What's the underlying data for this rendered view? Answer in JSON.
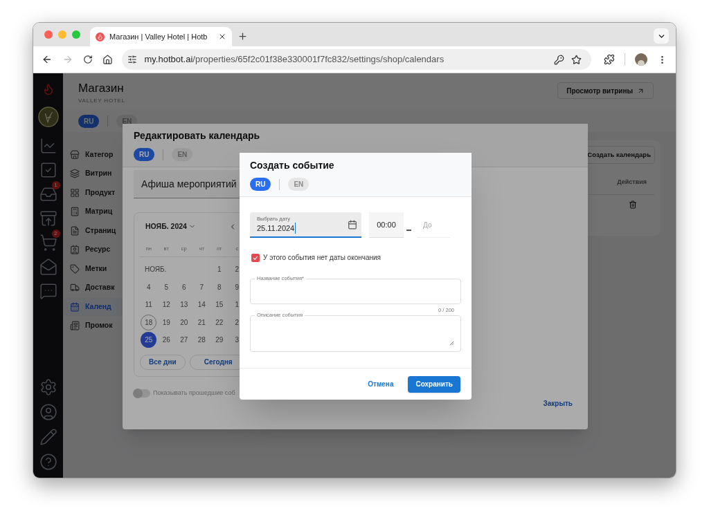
{
  "browser": {
    "tab_title": "Магазин | Valley Hotel | Hotb",
    "url_host": "my.hotbot.ai",
    "url_path": "/properties/65f2c01f38e330001f7fc832/settings/shop/calendars"
  },
  "sidebar": {
    "items": [
      {
        "kind": "chart"
      },
      {
        "kind": "check"
      },
      {
        "kind": "inbox",
        "badge": "1"
      },
      {
        "kind": "tray-star"
      },
      {
        "kind": "cart",
        "badge": "2"
      },
      {
        "kind": "mail"
      },
      {
        "kind": "chat"
      }
    ],
    "bottom_items": [
      {
        "kind": "settings"
      },
      {
        "kind": "user"
      },
      {
        "kind": "pencil"
      },
      {
        "kind": "help"
      }
    ]
  },
  "page": {
    "title": "Магазин",
    "subtitle": "VALLEY HOTEL",
    "preview_button": "Просмотр витрины",
    "languages": [
      {
        "label": "RU",
        "selected": true
      },
      {
        "label": "EN",
        "selected": false
      }
    ],
    "menu": [
      {
        "label": "Категор",
        "kind": "store",
        "selected": false
      },
      {
        "label": "Витрин",
        "kind": "cards",
        "selected": false
      },
      {
        "label": "Продукт",
        "kind": "grid",
        "selected": false
      },
      {
        "label": "Матриц",
        "kind": "matrix",
        "selected": false
      },
      {
        "label": "Страниц",
        "kind": "page",
        "selected": false
      },
      {
        "label": "Ресурс",
        "kind": "resource",
        "selected": false
      },
      {
        "label": "Метки",
        "kind": "tag",
        "selected": false
      },
      {
        "label": "Доставк",
        "kind": "truck",
        "selected": false
      },
      {
        "label": "Календ",
        "kind": "calendar",
        "selected": true
      },
      {
        "label": "Промок",
        "kind": "promo",
        "selected": false
      }
    ],
    "create_calendar_button": "Создать календарь",
    "actions_header": "Действия"
  },
  "edit_dialog": {
    "title": "Редактировать календарь",
    "languages": [
      {
        "label": "RU",
        "selected": true
      },
      {
        "label": "EN",
        "selected": false
      }
    ],
    "name_value": "Афиша мероприятий",
    "calendar": {
      "month_label": "НОЯБ. 2024",
      "weekdays": [
        "пн",
        "вт",
        "ср",
        "чт",
        "пт",
        "с"
      ],
      "month_short": "НОЯБ.",
      "first_days": [
        {
          "text": "1",
          "selected": false,
          "today": false
        },
        {
          "text": "2",
          "selected": false,
          "today": false
        }
      ],
      "weeks": [
        [
          {
            "text": "4",
            "selected": false,
            "today": false
          },
          {
            "text": "5",
            "selected": false,
            "today": false
          },
          {
            "text": "6",
            "selected": false,
            "today": false
          },
          {
            "text": "7",
            "selected": false,
            "today": false
          },
          {
            "text": "8",
            "selected": false,
            "today": false
          },
          {
            "text": "9",
            "selected": false,
            "today": false
          }
        ],
        [
          {
            "text": "11",
            "selected": false,
            "today": false
          },
          {
            "text": "12",
            "selected": false,
            "today": false
          },
          {
            "text": "13",
            "selected": false,
            "today": false
          },
          {
            "text": "14",
            "selected": false,
            "today": false
          },
          {
            "text": "15",
            "selected": false,
            "today": false
          },
          {
            "text": "1",
            "selected": false,
            "today": false
          }
        ],
        [
          {
            "text": "18",
            "selected": false,
            "today": true
          },
          {
            "text": "19",
            "selected": false,
            "today": false
          },
          {
            "text": "20",
            "selected": false,
            "today": false
          },
          {
            "text": "21",
            "selected": false,
            "today": false
          },
          {
            "text": "22",
            "selected": false,
            "today": false
          },
          {
            "text": "2",
            "selected": false,
            "today": false
          }
        ],
        [
          {
            "text": "25",
            "selected": true,
            "today": false
          },
          {
            "text": "26",
            "selected": false,
            "today": false
          },
          {
            "text": "27",
            "selected": false,
            "today": false
          },
          {
            "text": "28",
            "selected": false,
            "today": false
          },
          {
            "text": "29",
            "selected": false,
            "today": false
          },
          {
            "text": "3",
            "selected": false,
            "today": false
          }
        ]
      ]
    },
    "all_days_button": "Все дни",
    "today_button": "Сегодня",
    "show_past": {
      "label": "Показывать прошедшие соб",
      "on": false
    },
    "close_button": "Закрыть"
  },
  "create_dialog": {
    "title": "Создать событие",
    "languages": [
      {
        "label": "RU",
        "selected": true
      },
      {
        "label": "EN",
        "selected": false
      }
    ],
    "date_field": {
      "label": "Выбрать дату",
      "value": "25.11.2024"
    },
    "time_from": "00:00",
    "time_to_placeholder": "До",
    "no_end_date": {
      "label": "У этого события нет даты окончания",
      "checked": true
    },
    "name_field": {
      "label": "Название события*",
      "counter": "0 / 200"
    },
    "description_field": {
      "label": "Описание события"
    },
    "cancel_button": "Отмена",
    "save_button": "Сохранить"
  }
}
